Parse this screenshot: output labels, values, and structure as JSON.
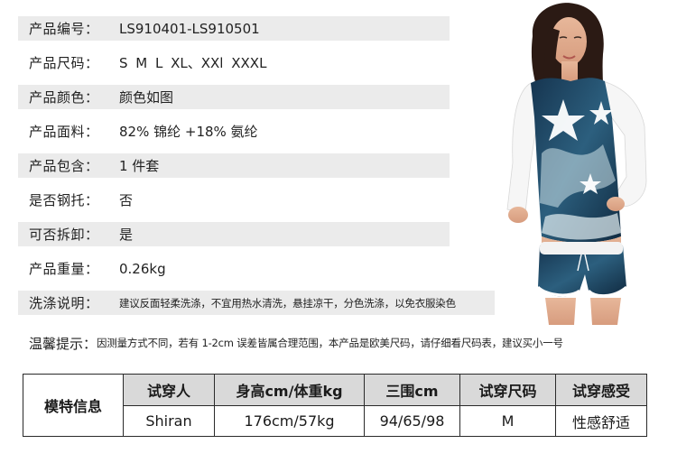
{
  "specs": [
    {
      "label": "产品编号：",
      "value": "LS910401-LS910501"
    },
    {
      "label": "产品尺码：",
      "value": "S M L XL、XXl XXXL"
    },
    {
      "label": "产品颜色：",
      "value": "颜色如图"
    },
    {
      "label": "产品面料：",
      "value": "82% 锦纶 +18% 氨纶"
    },
    {
      "label": "产品包含：",
      "value": "1 件套"
    },
    {
      "label": "是否钢托：",
      "value": "否"
    },
    {
      "label": "可否拆卸：",
      "value": "是"
    },
    {
      "label": "产品重量：",
      "value": "0.26kg"
    },
    {
      "label": "洗涤说明：",
      "value": "建议反面轻柔洗涤，不宜用热水清洗，悬挂凉干，分色洗涤，以免衣服染色"
    }
  ],
  "note": {
    "label": "温馨提示：",
    "value": "因测量方式不同，若有 1-2cm 误差皆属合理范围，本产品是欧美尺码，请仔细看尺码表，建议买小一号"
  },
  "model_table": {
    "group_label": "模特信息",
    "headers": [
      "试穿人",
      "身高cm/体重kg",
      "三围cm",
      "试穿尺码",
      "试穿感受"
    ],
    "row": [
      "Shiran",
      "176cm/57kg",
      "94/65/98",
      "M",
      "性感舒适"
    ]
  },
  "colors": {
    "row_shade": "#ebebeb",
    "table_header": "#d9d9d9",
    "print_navy": "#1d3f5a"
  }
}
